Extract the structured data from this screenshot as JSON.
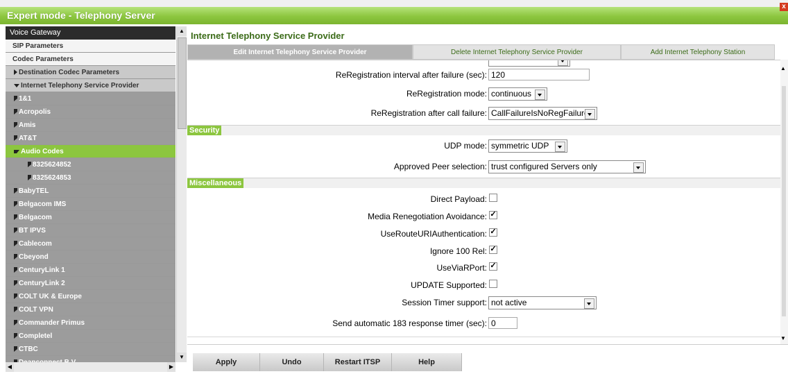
{
  "window": {
    "title": "Expert mode - Telephony Server",
    "close_glyph": "x"
  },
  "sidebar": {
    "header": "Voice Gateway",
    "items": [
      {
        "label": "SIP Parameters",
        "style": "white",
        "level": 0,
        "arrow": ""
      },
      {
        "label": "Codec Parameters",
        "style": "white",
        "level": 0,
        "arrow": ""
      },
      {
        "label": "Destination Codec Parameters",
        "style": "mid",
        "level": 1,
        "arrow": "right"
      },
      {
        "label": "Internet Telephony Service Provider",
        "style": "mid",
        "level": 1,
        "arrow": "down"
      },
      {
        "label": "1&1",
        "style": "dark",
        "level": 1,
        "arrow": "right"
      },
      {
        "label": "Acropolis",
        "style": "dark",
        "level": 1,
        "arrow": "right"
      },
      {
        "label": "Amis",
        "style": "dark",
        "level": 1,
        "arrow": "right"
      },
      {
        "label": "AT&T",
        "style": "dark",
        "level": 1,
        "arrow": "right"
      },
      {
        "label": "Audio Codes",
        "style": "green",
        "level": 1,
        "arrow": "down"
      },
      {
        "label": "8325624852",
        "style": "dark",
        "level": 2,
        "arrow": "right"
      },
      {
        "label": "8325624853",
        "style": "dark",
        "level": 2,
        "arrow": "right"
      },
      {
        "label": "BabyTEL",
        "style": "dark",
        "level": 1,
        "arrow": "right"
      },
      {
        "label": "Belgacom IMS",
        "style": "dark",
        "level": 1,
        "arrow": "right"
      },
      {
        "label": "Belgacom",
        "style": "dark",
        "level": 1,
        "arrow": "right"
      },
      {
        "label": "BT IPVS",
        "style": "dark",
        "level": 1,
        "arrow": "right"
      },
      {
        "label": "Cablecom",
        "style": "dark",
        "level": 1,
        "arrow": "right"
      },
      {
        "label": "Cbeyond",
        "style": "dark",
        "level": 1,
        "arrow": "right"
      },
      {
        "label": "CenturyLink 1",
        "style": "dark",
        "level": 1,
        "arrow": "right"
      },
      {
        "label": "CenturyLink 2",
        "style": "dark",
        "level": 1,
        "arrow": "right"
      },
      {
        "label": "COLT UK & Europe",
        "style": "dark",
        "level": 1,
        "arrow": "right"
      },
      {
        "label": "COLT VPN",
        "style": "dark",
        "level": 1,
        "arrow": "right"
      },
      {
        "label": "Commander Primus",
        "style": "dark",
        "level": 1,
        "arrow": "right"
      },
      {
        "label": "Completel",
        "style": "dark",
        "level": 1,
        "arrow": "right"
      },
      {
        "label": "CTBC",
        "style": "dark",
        "level": 1,
        "arrow": "right"
      },
      {
        "label": "Deanconnect B.V.",
        "style": "dark",
        "level": 1,
        "arrow": "right"
      }
    ]
  },
  "main": {
    "title": "Internet Telephony Service Provider",
    "tabs": [
      {
        "label": "Edit Internet Telephony Service Provider",
        "active": true
      },
      {
        "label": "Delete Internet Telephony Service Provider",
        "active": false
      },
      {
        "label": "Add Internet Telephony Station",
        "active": false
      }
    ],
    "rows_top": [
      {
        "label": "ReRegistration interval after failure (sec):",
        "type": "input",
        "value": "120"
      },
      {
        "label": "ReRegistration mode:",
        "type": "select",
        "value": "continuous"
      },
      {
        "label": "ReRegistration after call failure:",
        "type": "select",
        "value": "CallFailureIsNoRegFailure"
      }
    ],
    "security": {
      "title": "Security",
      "rows": [
        {
          "label": "UDP mode:",
          "type": "select",
          "value": "symmetric UDP"
        },
        {
          "label": "Approved Peer selection:",
          "type": "select",
          "value": "trust configured Servers only"
        }
      ]
    },
    "misc": {
      "title": "Miscellaneous",
      "rows": [
        {
          "label": "Direct Payload:",
          "type": "checkbox",
          "checked": false
        },
        {
          "label": "Media Renegotiation Avoidance:",
          "type": "checkbox",
          "checked": true
        },
        {
          "label": "UseRouteURIAuthentication:",
          "type": "checkbox",
          "checked": true
        },
        {
          "label": "Ignore 100 Rel:",
          "type": "checkbox",
          "checked": true
        },
        {
          "label": "UseViaRPort:",
          "type": "checkbox",
          "checked": true
        },
        {
          "label": "UPDATE Supported:",
          "type": "checkbox",
          "checked": false
        },
        {
          "label": "Session Timer support:",
          "type": "select",
          "value": "not active"
        },
        {
          "label": "Send automatic 183 response timer (sec):",
          "type": "input",
          "value": "0"
        }
      ]
    },
    "buttons": [
      "Apply",
      "Undo",
      "Restart ITSP",
      "Help"
    ]
  },
  "colors": {
    "accent": "#8cc63f",
    "title_text": "#3b6b18"
  }
}
